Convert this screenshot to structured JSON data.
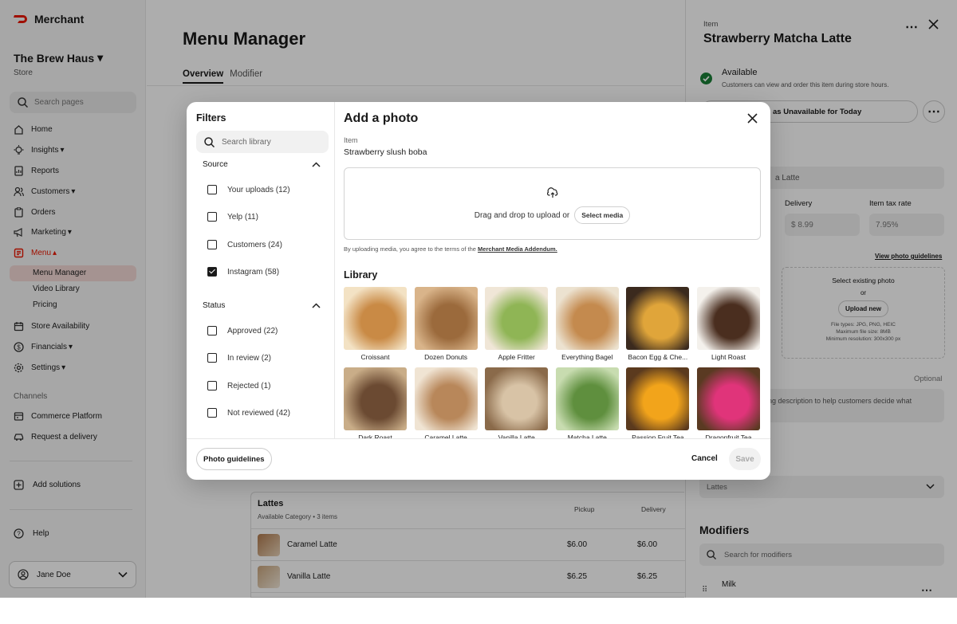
{
  "brand": "Merchant",
  "store": {
    "name": "The Brew Haus",
    "type": "Store"
  },
  "sidebar": {
    "search_placeholder": "Search pages",
    "items": [
      {
        "label": "Home",
        "icon": "home-icon"
      },
      {
        "label": "Insights",
        "icon": "bulb-icon",
        "chev": true
      },
      {
        "label": "Reports",
        "icon": "report-icon"
      },
      {
        "label": "Customers",
        "icon": "people-icon",
        "chev": true
      },
      {
        "label": "Orders",
        "icon": "clipboard-icon"
      },
      {
        "label": "Marketing",
        "icon": "megaphone-icon",
        "chev": true
      },
      {
        "label": "Menu",
        "icon": "menu-book-icon",
        "chev": true,
        "active": true
      }
    ],
    "menu_sub": [
      "Menu Manager",
      "Video Library",
      "Pricing"
    ],
    "items2": [
      {
        "label": "Store Availability",
        "icon": "calendar-icon"
      },
      {
        "label": "Financials",
        "icon": "dollar-icon"
      },
      {
        "label": "Settings",
        "icon": "gear-icon"
      }
    ],
    "channels_label": "Channels",
    "channels": [
      {
        "label": "Commerce Platform"
      },
      {
        "label": "Request a delivery"
      }
    ],
    "add_solutions": "Add solutions",
    "help": "Help",
    "user": "Jane Doe"
  },
  "main": {
    "title": "Menu Manager",
    "tabs": [
      "Overview",
      "Modifier"
    ],
    "category": {
      "name": "Lattes",
      "subtitle": "Available Category  •  3 items",
      "col_pickup": "Pickup",
      "col_delivery": "Delivery"
    },
    "rows": [
      {
        "name": "Caramel Latte",
        "pickup": "$6.00",
        "delivery": "$6.00"
      },
      {
        "name": "Vanilla Latte",
        "pickup": "$6.25",
        "delivery": "$6.25"
      }
    ]
  },
  "panel": {
    "label": "Item",
    "title": "Strawberry Matcha Latte",
    "status": "Available",
    "status_desc": "Customers can view and order this item during store hours.",
    "mark_btn": "as Unavailable for Today",
    "name_val": "a Latte",
    "delivery_label": "Delivery",
    "delivery_val": "$ 8.99",
    "tax_label": "Item tax rate",
    "tax_val": "7.95%",
    "guidelines_link": "View photo guidelines",
    "select_existing": "Select existing photo",
    "or": "or",
    "upload_new": "Upload new",
    "file_types": "File types: JPG, PNG, HEIC",
    "max_size": "Maximum file size: 8MB",
    "min_res": "Minimum resolution: 300x300 px",
    "optional": "Optional",
    "desc_placeholder": "ing description to help customers decide what",
    "category_val": "Lattes",
    "modifiers_title": "Modifiers",
    "modifiers_search": "Search for modifiers",
    "modifier_item": "Milk"
  },
  "modal": {
    "filters_title": "Filters",
    "filters_search": "Search library",
    "source_label": "Source",
    "source": [
      {
        "label": "Your uploads (12)",
        "checked": false
      },
      {
        "label": "Yelp (11)",
        "checked": false
      },
      {
        "label": "Customers (24)",
        "checked": false
      },
      {
        "label": "Instagram (58)",
        "checked": true
      }
    ],
    "status_label": "Status",
    "status": [
      {
        "label": "Approved (22)"
      },
      {
        "label": "In review (2)"
      },
      {
        "label": "Rejected (1)"
      },
      {
        "label": "Not reviewed (42)"
      }
    ],
    "title": "Add a photo",
    "item_label": "Item",
    "item_value": "Strawberry slush boba",
    "drop_text": "Drag and drop to upload or",
    "select_media": "Select media",
    "terms": "By uploading media, you agree to the terms of the",
    "terms_link": "Merchant Media Addendum.",
    "library_title": "Library",
    "library": [
      {
        "name": "Croissant",
        "c1": "#c98a45",
        "c2": "#f3e2c4"
      },
      {
        "name": "Dozen Donuts",
        "c1": "#9b6a3c",
        "c2": "#d9b48a"
      },
      {
        "name": "Apple Fritter",
        "c1": "#8fb555",
        "c2": "#f0e6d7"
      },
      {
        "name": "Everything Bagel",
        "c1": "#c48a4e",
        "c2": "#ece2d0"
      },
      {
        "name": "Bacon Egg & Che...",
        "c1": "#e0a53a",
        "c2": "#3b2a1e"
      },
      {
        "name": "Light Roast",
        "c1": "#4a2e1f",
        "c2": "#f4f1ec"
      },
      {
        "name": "Dark Roast",
        "c1": "#6b4a32",
        "c2": "#c9ad88"
      },
      {
        "name": "Caramel Latte",
        "c1": "#b8875a",
        "c2": "#f0e4d3"
      },
      {
        "name": "Vanilla Latte",
        "c1": "#d8c3a6",
        "c2": "#8a6a4a"
      },
      {
        "name": "Matcha Latte",
        "c1": "#5f8f3e",
        "c2": "#c8dcb0"
      },
      {
        "name": "Passion Fruit Tea",
        "c1": "#f2a41b",
        "c2": "#5b3a1e"
      },
      {
        "name": "Dragonfruit Tea",
        "c1": "#e0347a",
        "c2": "#5a3a22"
      }
    ],
    "photo_guidelines": "Photo guidelines",
    "cancel": "Cancel",
    "save": "Save"
  }
}
